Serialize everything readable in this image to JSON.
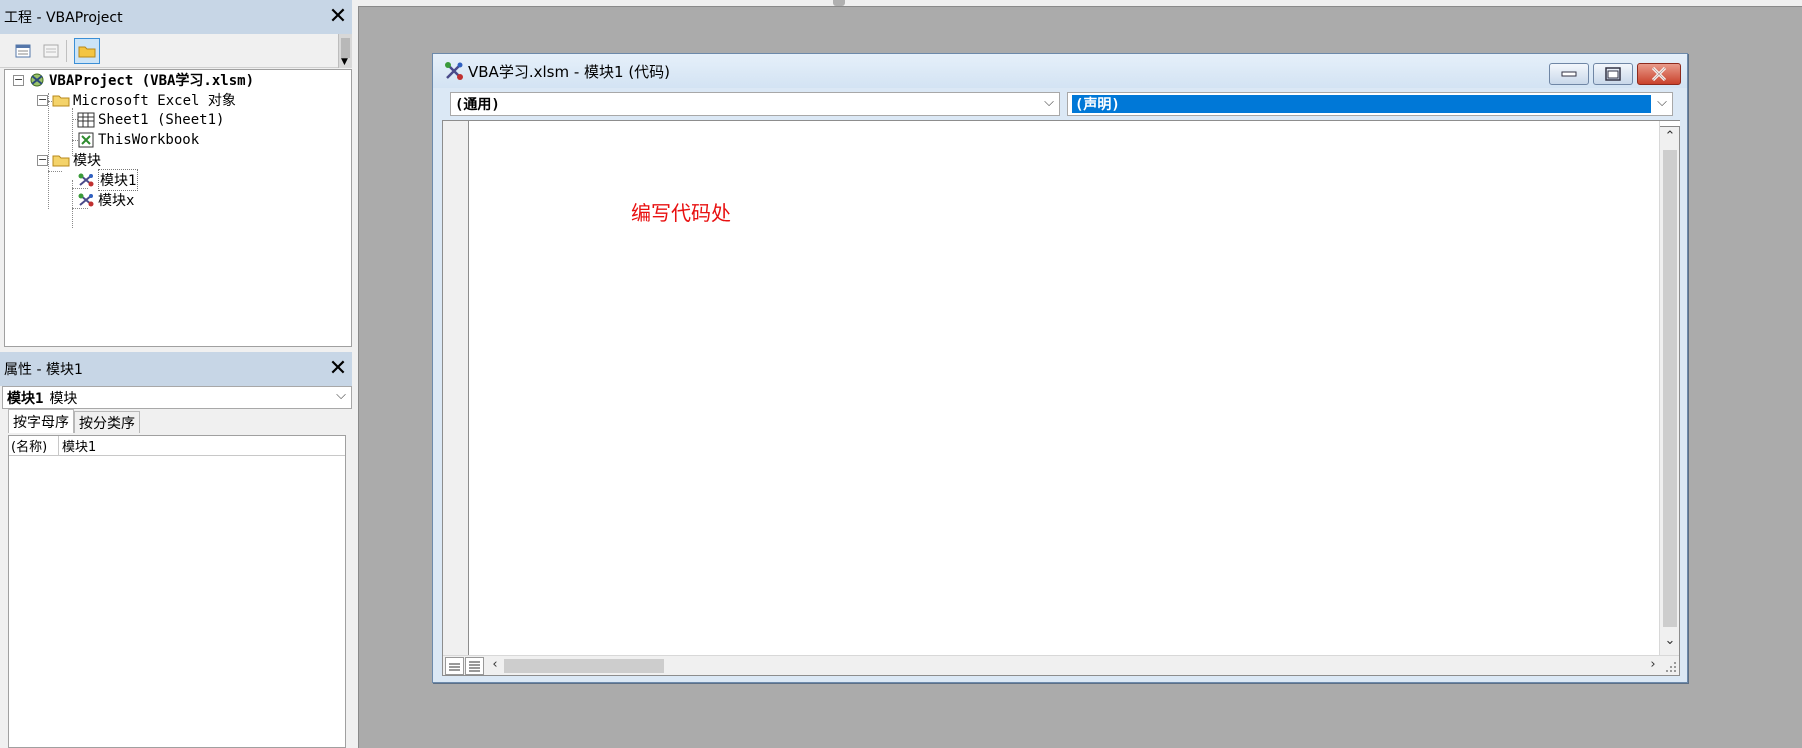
{
  "project_pane": {
    "title": "工程 - VBAProject",
    "tree": {
      "root_label": "VBAProject (VBA学习.xlsm)",
      "excel_objects_folder": "Microsoft Excel 对象",
      "sheet1": "Sheet1 (Sheet1)",
      "this_workbook": "ThisWorkbook",
      "modules_folder": "模块",
      "module1": "模块1",
      "modulex": "模块x"
    }
  },
  "properties_pane": {
    "title": "属性 - 模块1",
    "object_select_name": "模块1",
    "object_select_type": "模块",
    "tabs": [
      "按字母序",
      "按分类序"
    ],
    "rows": [
      {
        "name": "(名称)",
        "value": "模块1"
      }
    ]
  },
  "code_window": {
    "title": "VBA学习.xlsm - 模块1 (代码)",
    "object_combo": "(通用)",
    "procedure_combo": "(声明)",
    "annotation": "编写代码处"
  },
  "colors": {
    "annotation": "#e81010",
    "selection": "#0078d7",
    "pane_title_bg": "#c7d6e6",
    "workspace_bg": "#ababab"
  },
  "icons": [
    "close-icon",
    "view-object-icon",
    "view-code-icon",
    "toggle-folders-icon",
    "project-icon",
    "folder-icon",
    "worksheet-icon",
    "workbook-icon",
    "module-icon",
    "minimize-icon",
    "maximize-icon",
    "chevron-down-icon"
  ]
}
